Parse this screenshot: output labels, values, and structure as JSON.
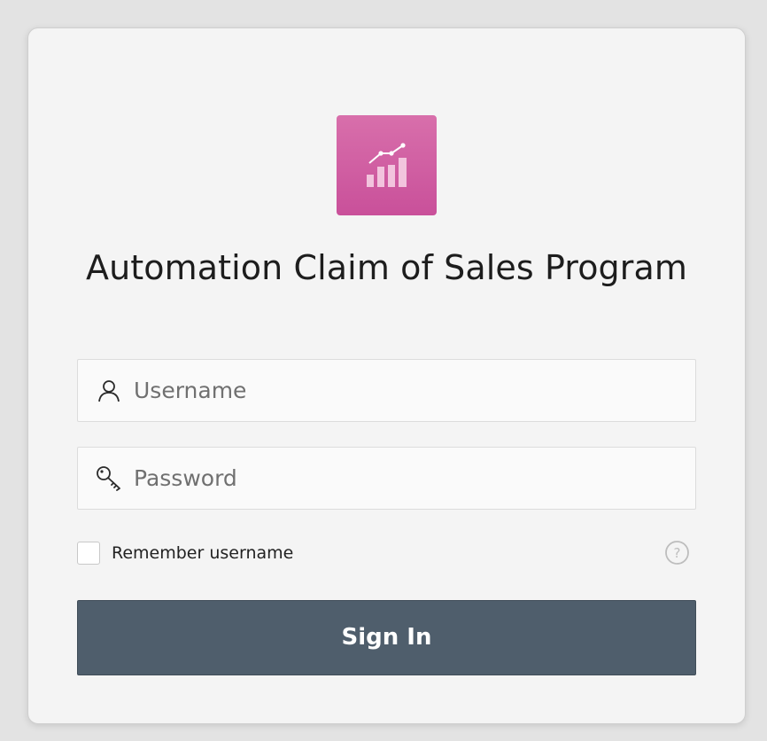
{
  "app": {
    "title": "Automation Claim of Sales Program",
    "logo_icon": "chart-trend-icon",
    "logo_color": "#d06aa6"
  },
  "form": {
    "username": {
      "placeholder": "Username",
      "value": "",
      "icon": "user-icon"
    },
    "password": {
      "placeholder": "Password",
      "value": "",
      "icon": "key-icon"
    },
    "remember": {
      "label": "Remember username",
      "checked": false
    },
    "help_icon": "help-circle-icon",
    "submit_label": "Sign In",
    "submit_color": "#4f5e6c"
  }
}
